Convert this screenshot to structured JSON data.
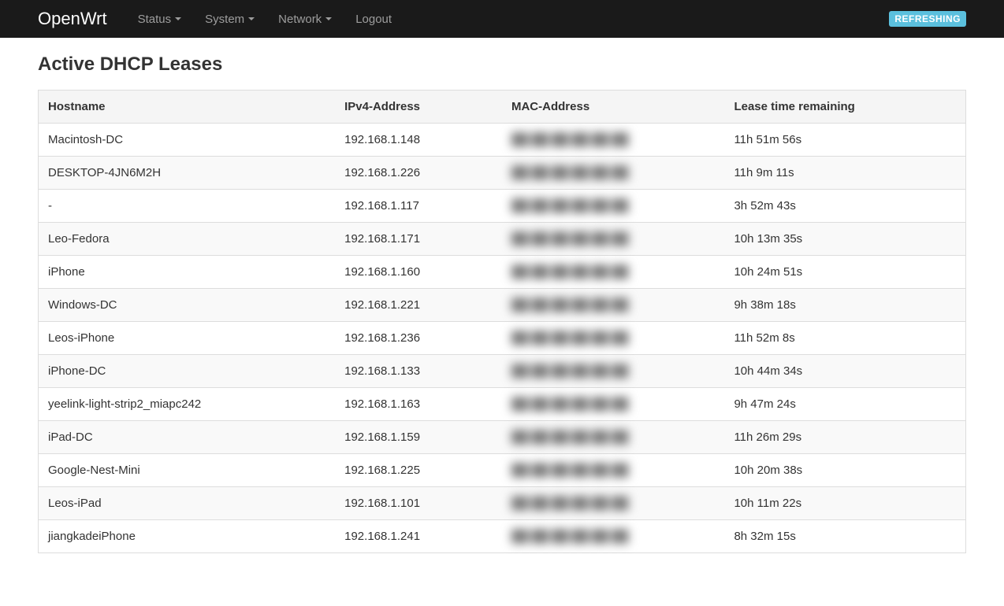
{
  "nav": {
    "brand": "OpenWrt",
    "items": [
      {
        "label": "Status",
        "dropdown": true
      },
      {
        "label": "System",
        "dropdown": true
      },
      {
        "label": "Network",
        "dropdown": true
      },
      {
        "label": "Logout",
        "dropdown": false
      }
    ],
    "refresh_badge": "REFRESHING"
  },
  "page": {
    "title": "Active DHCP Leases"
  },
  "table": {
    "headers": {
      "hostname": "Hostname",
      "ipv4": "IPv4-Address",
      "mac": "MAC-Address",
      "lease": "Lease time remaining"
    },
    "rows": [
      {
        "hostname": "Macintosh-DC",
        "ipv4": "192.168.1.148",
        "mac": "██:██:██:██:██:██",
        "lease": "11h 51m 56s"
      },
      {
        "hostname": "DESKTOP-4JN6M2H",
        "ipv4": "192.168.1.226",
        "mac": "██:██:██:██:██:██",
        "lease": "11h 9m 11s"
      },
      {
        "hostname": "-",
        "ipv4": "192.168.1.117",
        "mac": "██:██:██:██:██:██",
        "lease": "3h 52m 43s"
      },
      {
        "hostname": "Leo-Fedora",
        "ipv4": "192.168.1.171",
        "mac": "██:██:██:██:██:██",
        "lease": "10h 13m 35s"
      },
      {
        "hostname": "iPhone",
        "ipv4": "192.168.1.160",
        "mac": "██:██:██:██:██:██",
        "lease": "10h 24m 51s"
      },
      {
        "hostname": "Windows-DC",
        "ipv4": "192.168.1.221",
        "mac": "██:██:██:██:██:██",
        "lease": "9h 38m 18s"
      },
      {
        "hostname": "Leos-iPhone",
        "ipv4": "192.168.1.236",
        "mac": "██:██:██:██:██:██",
        "lease": "11h 52m 8s"
      },
      {
        "hostname": "iPhone-DC",
        "ipv4": "192.168.1.133",
        "mac": "██:██:██:██:██:██",
        "lease": "10h 44m 34s"
      },
      {
        "hostname": "yeelink-light-strip2_miapc242",
        "ipv4": "192.168.1.163",
        "mac": "██:██:██:██:██:██",
        "lease": "9h 47m 24s"
      },
      {
        "hostname": "iPad-DC",
        "ipv4": "192.168.1.159",
        "mac": "██:██:██:██:██:██",
        "lease": "11h 26m 29s"
      },
      {
        "hostname": "Google-Nest-Mini",
        "ipv4": "192.168.1.225",
        "mac": "██:██:██:██:██:██",
        "lease": "10h 20m 38s"
      },
      {
        "hostname": "Leos-iPad",
        "ipv4": "192.168.1.101",
        "mac": "██:██:██:██:██:██",
        "lease": "10h 11m 22s"
      },
      {
        "hostname": "jiangkadeiPhone",
        "ipv4": "192.168.1.241",
        "mac": "██:██:██:██:██:██",
        "lease": "8h 32m 15s"
      }
    ]
  }
}
